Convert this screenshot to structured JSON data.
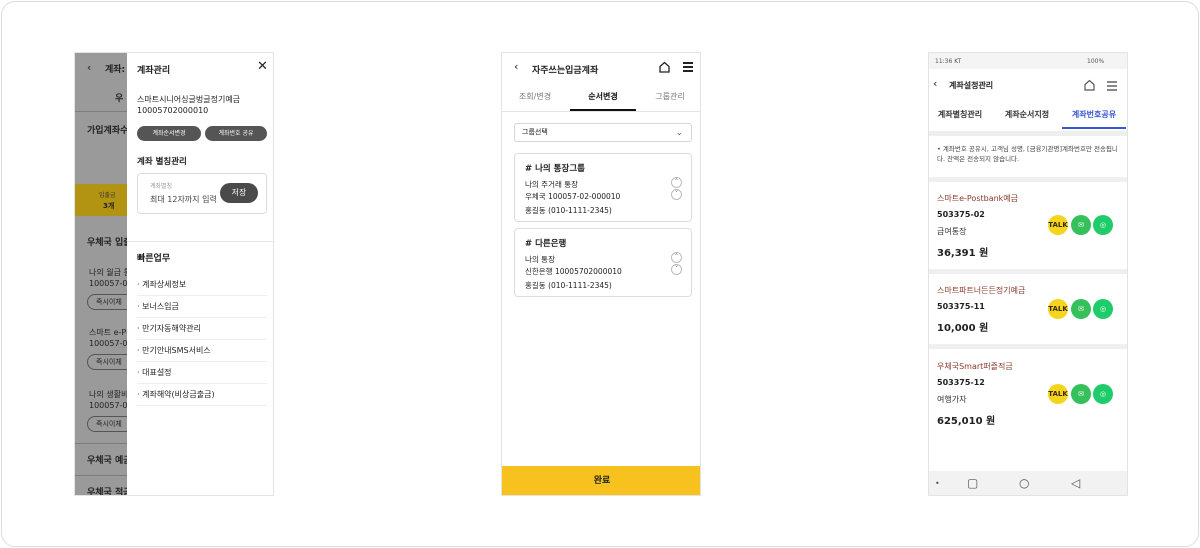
{
  "screen1": {
    "bg": {
      "title": "계좌:",
      "tab": "우",
      "section1": "가입계좌수",
      "gold_line1": "입출금",
      "gold_line2": "3개",
      "section2": "우체국 입출",
      "item1_name": "나의 월급 통",
      "item1_num": "100057-0",
      "item1_btn": "즉시이체",
      "item2_name": "스마트 e-P",
      "item2_num": "100057-0",
      "item2_btn": "즉시이체",
      "item3_name": "나의 생활비",
      "item3_num": "100057-0",
      "item3_btn": "즉시이체",
      "section3": "우체국 예금",
      "section4": "우체국 적금"
    },
    "drawer": {
      "title": "계좌관리",
      "account_name": "스마트시니어싱글벙글정기예금",
      "account_number": "10005702000010",
      "btn_order": "계좌순서변경",
      "btn_share": "계좌번호 공유",
      "alias_section": "계좌 별칭관리",
      "alias_label": "계좌별칭",
      "alias_placeholder": "최대 12자까지 입력",
      "save_label": "저장",
      "quick_title": "빠른업무",
      "quick_items": [
        "계좌상세정보",
        "보너스입금",
        "만기자동해약관리",
        "만기안내SMS서비스",
        "대표설정",
        "계좌해약(비상금출금)"
      ]
    }
  },
  "screen2": {
    "title": "자주쓰는입금계좌",
    "tabs": [
      "조회/변경",
      "순서변경",
      "그룹관리"
    ],
    "group_select": "그룹선택",
    "cards": [
      {
        "group": "# 나의 통장그룹",
        "alias": "나의 주거래 통장",
        "account": "우체국 100057-02-000010",
        "owner": "홍길동 (010-1111-2345)"
      },
      {
        "group": "# 다른은행",
        "alias": "나의 통장",
        "account": "신한은행 10005702000010",
        "owner": "홍길동 (010-1111-2345)"
      }
    ],
    "done_label": "완료"
  },
  "screen3": {
    "status_left": "11:36 KT",
    "status_right": "100%",
    "title": "계좌설정관리",
    "tabs": [
      "계좌별칭관리",
      "계좌순서지정",
      "계좌번호공유"
    ],
    "notice": "• 계좌번호 공유시, 고객님 성명, [금융기관명]계좌번호만 전송됩니다. 잔액은 전송되지 않습니다.",
    "accounts": [
      {
        "product": "스마트e-Postbank예금",
        "number": "503375-02",
        "alias": "급여통장",
        "amount": "36,391 원"
      },
      {
        "product": "스마트파트너든든정기예금",
        "number": "503375-11",
        "alias": "",
        "amount": "10,000 원"
      },
      {
        "product": "우체국Smart퍼즐적금",
        "number": "503375-12",
        "alias": "여행가자",
        "amount": "625,010 원"
      }
    ],
    "share_icons": [
      "kakao-talk",
      "sms",
      "line"
    ],
    "share_labels": [
      "TALK",
      "✉",
      "◎"
    ]
  }
}
